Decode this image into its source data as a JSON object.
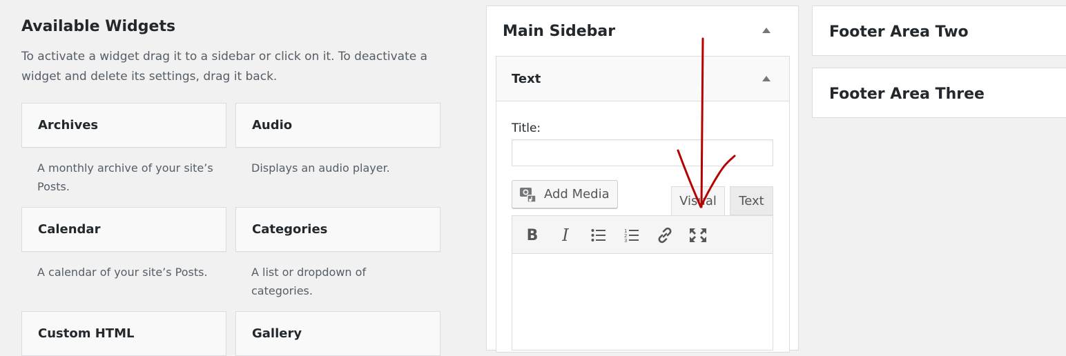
{
  "available": {
    "title": "Available Widgets",
    "description": "To activate a widget drag it to a sidebar or click on it. To deactivate a widget and delete its settings, drag it back.",
    "widgets": [
      {
        "name": "Archives",
        "description": "A monthly archive of your site’s Posts."
      },
      {
        "name": "Audio",
        "description": "Displays an audio player."
      },
      {
        "name": "Calendar",
        "description": "A calendar of your site’s Posts."
      },
      {
        "name": "Categories",
        "description": "A list or dropdown of categories."
      },
      {
        "name": "Custom HTML",
        "description": ""
      },
      {
        "name": "Gallery",
        "description": ""
      }
    ]
  },
  "main_sidebar": {
    "title": "Main Sidebar",
    "text_widget": {
      "header": "Text",
      "title_label": "Title:",
      "title_value": "",
      "add_media_label": "Add Media",
      "tabs": [
        "Visual",
        "Text"
      ],
      "active_tab": "Visual",
      "toolbar": [
        "bold-icon",
        "italic-icon",
        "bulleted-list-icon",
        "numbered-list-icon",
        "link-icon",
        "fullscreen-icon"
      ]
    }
  },
  "footer_areas": [
    {
      "title": "Footer Area Two"
    },
    {
      "title": "Footer Area Three"
    }
  ],
  "annotation": {
    "color": "#b50000",
    "icon": "red-hand-drawn-arrow-icon"
  }
}
